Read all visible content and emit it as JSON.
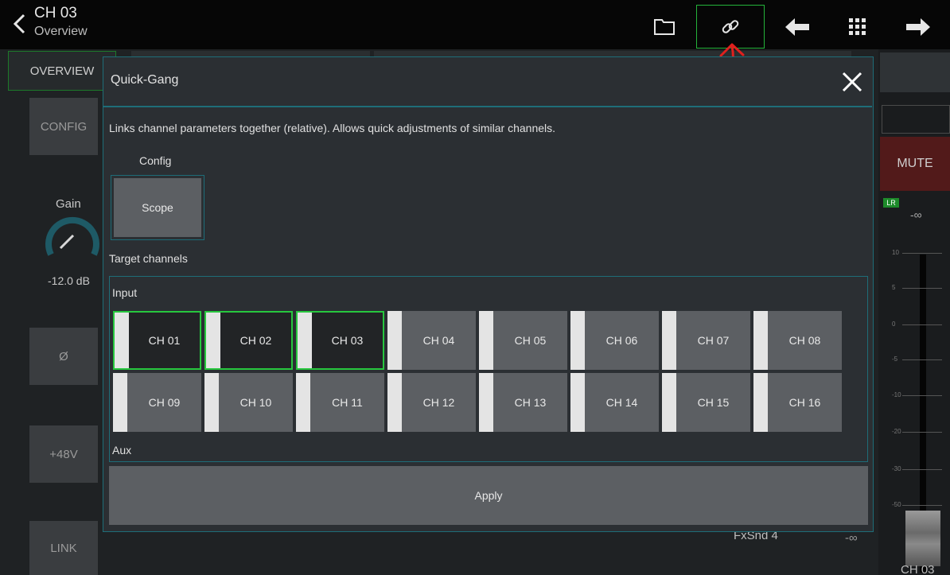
{
  "header": {
    "title": "CH 03",
    "subtitle": "Overview",
    "icons": [
      "back-chevron-icon",
      "folder-icon",
      "link-icon",
      "arrow-left-icon",
      "grid-icon",
      "arrow-right-icon"
    ]
  },
  "background": {
    "tab_overview": "OVERVIEW",
    "config_label": "CONFIG",
    "gain_label": "Gain",
    "gain_value": "-12.0 dB",
    "phase_label": "Ø",
    "phantom_label": "+48V",
    "link_label": "LINK",
    "mute_label": "MUTE",
    "lr_tag": "LR",
    "lr_value": "-∞",
    "fader_scale": [
      "10",
      "5",
      "0",
      "-5",
      "-10",
      "-20",
      "-30",
      "-50"
    ],
    "fxsnd_label": "FxSnd 4",
    "fxsnd_value": "-∞",
    "channel_name": "CH 03"
  },
  "modal": {
    "title": "Quick-Gang",
    "description": "Links channel parameters together (relative). Allows quick adjustments of similar channels.",
    "config_label": "Config",
    "scope_label": "Scope",
    "target_label": "Target channels",
    "input_label": "Input",
    "aux_label": "Aux",
    "apply_label": "Apply",
    "channels": [
      {
        "label": "CH 01",
        "selected": true
      },
      {
        "label": "CH 02",
        "selected": true
      },
      {
        "label": "CH 03",
        "selected": true
      },
      {
        "label": "CH 04",
        "selected": false
      },
      {
        "label": "CH 05",
        "selected": false
      },
      {
        "label": "CH 06",
        "selected": false
      },
      {
        "label": "CH 07",
        "selected": false
      },
      {
        "label": "CH 08",
        "selected": false
      },
      {
        "label": "CH 09",
        "selected": false
      },
      {
        "label": "CH 10",
        "selected": false
      },
      {
        "label": "CH 11",
        "selected": false
      },
      {
        "label": "CH 12",
        "selected": false
      },
      {
        "label": "CH 13",
        "selected": false
      },
      {
        "label": "CH 14",
        "selected": false
      },
      {
        "label": "CH 15",
        "selected": false
      },
      {
        "label": "CH 16",
        "selected": false
      }
    ]
  },
  "colors": {
    "accent_green": "#27c73e",
    "modal_border": "#1e6d78",
    "annotation_red": "#e0201e"
  }
}
